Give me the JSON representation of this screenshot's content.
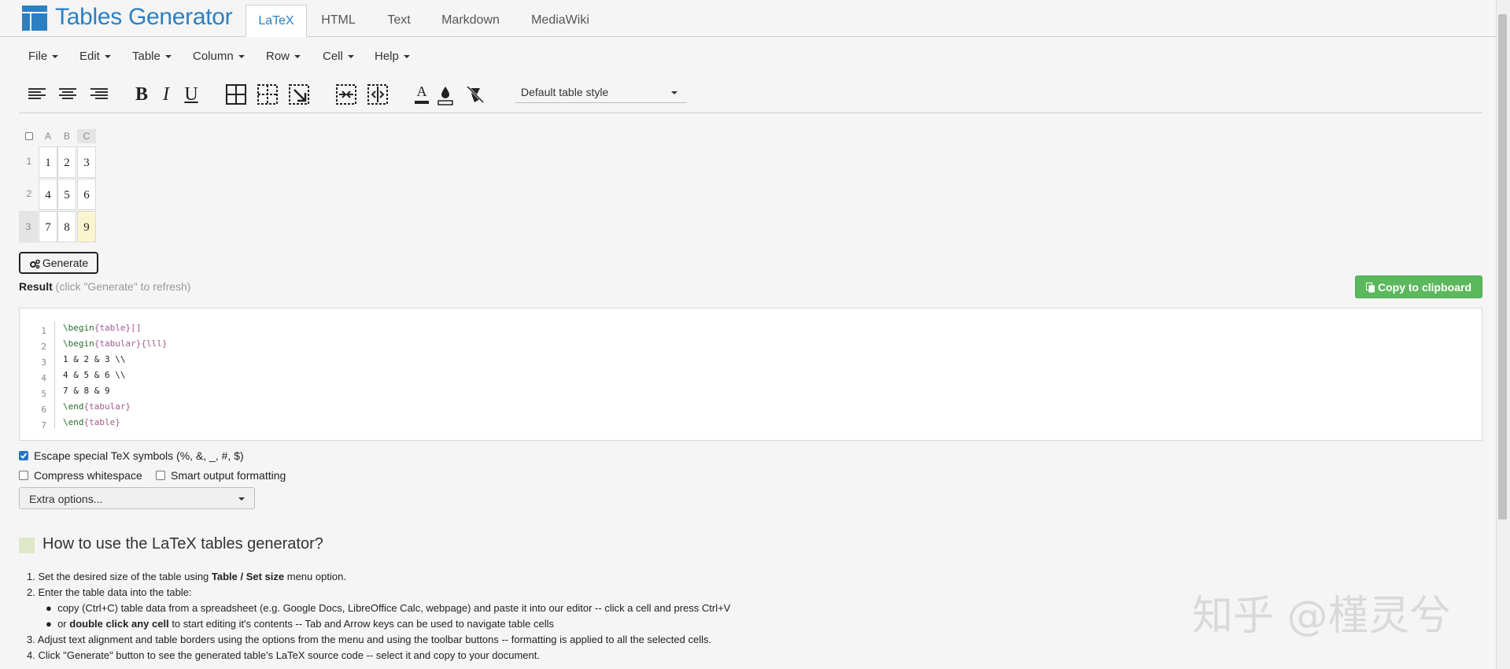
{
  "app": {
    "logo_text": "Tables Generator",
    "tabs": [
      {
        "label": "LaTeX",
        "active": true
      },
      {
        "label": "HTML"
      },
      {
        "label": "Text"
      },
      {
        "label": "Markdown"
      },
      {
        "label": "MediaWiki"
      }
    ],
    "brand_color": "#2d7fc0"
  },
  "menu": {
    "items": [
      "File",
      "Edit",
      "Table",
      "Column",
      "Row",
      "Cell",
      "Help"
    ]
  },
  "toolbar": {
    "icons": [
      "align-left-icon",
      "align-center-icon",
      "align-right-icon",
      "bold-icon",
      "italic-icon",
      "underline-icon",
      "all-borders-icon",
      "dashed-borders-icon",
      "cell-borders-icon",
      "merge-cells-icon",
      "split-cells-icon",
      "text-color-icon",
      "background-color-icon",
      "clear-format-icon"
    ],
    "bold_glyph": "B",
    "italic_glyph": "I",
    "underline_glyph": "U",
    "text_color_glyph": "A",
    "style_select": "Default table style"
  },
  "grid": {
    "columns": [
      "A",
      "B",
      "C"
    ],
    "rows": [
      "1",
      "2",
      "3"
    ],
    "cells": [
      [
        "1",
        "2",
        "3"
      ],
      [
        "4",
        "5",
        "6"
      ],
      [
        "7",
        "8",
        "9"
      ]
    ],
    "selected": {
      "row": 2,
      "col": 2,
      "color": "#fbf5cf"
    }
  },
  "generate": {
    "label": "Generate"
  },
  "result": {
    "label": "Result",
    "hint": " (click \"Generate\" to refresh)",
    "copy_label": "Copy to clipboard",
    "copy_color": "#5cb85c"
  },
  "code": {
    "line_numbers": [
      "1",
      "2",
      "3",
      "4",
      "5",
      "6",
      "7"
    ],
    "lines": [
      {
        "kw": "\\begin",
        "arg": "table",
        "rest": "[]"
      },
      {
        "kw": "\\begin",
        "arg": "tabular",
        "rest": "{lll}"
      },
      {
        "text": "1 & 2 & 3 \\\\"
      },
      {
        "text": "4 & 5 & 6 \\\\"
      },
      {
        "text": "7 & 8 & 9"
      },
      {
        "kw": "\\end",
        "arg": "tabular"
      },
      {
        "kw": "\\end",
        "arg": "table"
      }
    ]
  },
  "options": {
    "escape_label": "Escape special TeX symbols (%, &, _, #, $)",
    "escape_checked": true,
    "compress_label": "Compress whitespace",
    "compress_checked": false,
    "smart_label": "Smart output formatting",
    "smart_checked": false,
    "extra_label": "Extra options..."
  },
  "howto": {
    "title": "How to use the LaTeX tables generator?",
    "i1_a": "Set the desired size of the table using ",
    "i1_b": "Table / Set size",
    "i1_c": " menu option.",
    "i2": "Enter the table data into the table:",
    "i2a": "copy (Ctrl+C) table data from a spreadsheet (e.g. Google Docs, LibreOffice Calc, webpage) and paste it into our editor -- click a cell and press Ctrl+V",
    "i2b_a": "or ",
    "i2b_b": "double click any cell",
    "i2b_c": " to start editing it's contents -- Tab and Arrow keys can be used to navigate table cells",
    "i3": "Adjust text alignment and table borders using the options from the menu and using the toolbar buttons -- formatting is applied to all the selected cells.",
    "i4": "Click \"Generate\" button to see the generated table's LaTeX source code -- select it and copy to your document."
  },
  "watermark": "知乎 @槿灵兮"
}
